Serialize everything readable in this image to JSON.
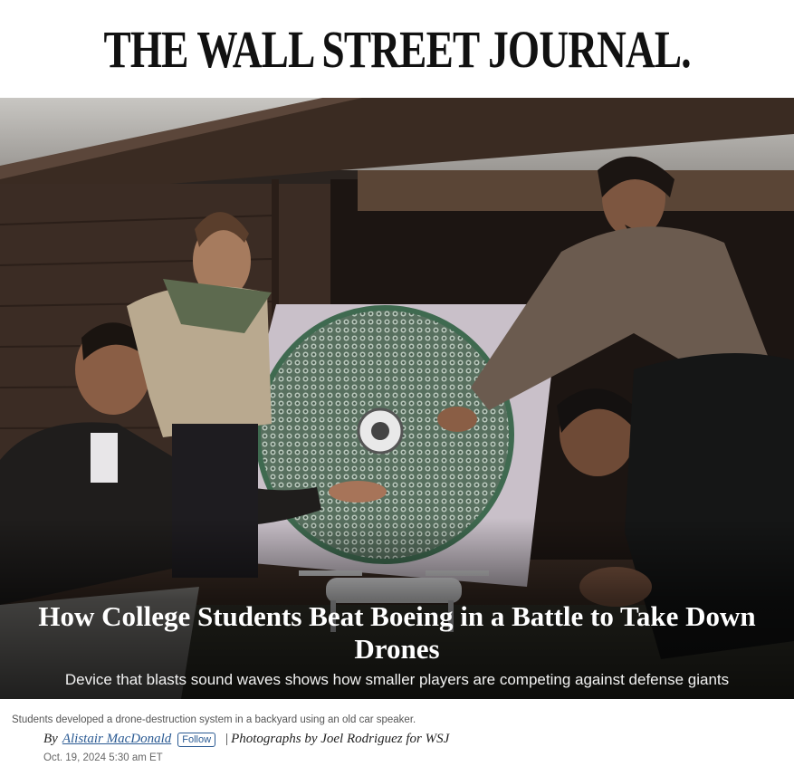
{
  "masthead": {
    "title": "THE WALL STREET JOURNAL."
  },
  "article": {
    "headline": "How College Students Beat Boeing in a Battle to Take Down Drones",
    "dek": "Device that blasts sound waves shows how smaller players are competing against defense giants",
    "photo_caption": "Students developed a drone-destruction system in a backyard using an old car speaker.",
    "byline_prefix": "By",
    "author": "Alistair MacDonald",
    "follow_label": "Follow",
    "byline_separator": "|",
    "photo_credit": "Photographs by Joel Rodriguez for WSJ",
    "timestamp": "Oct. 19, 2024 5:30 am ET"
  },
  "colors": {
    "link": "#2a5a93",
    "text": "#111111",
    "caption": "#555555"
  }
}
